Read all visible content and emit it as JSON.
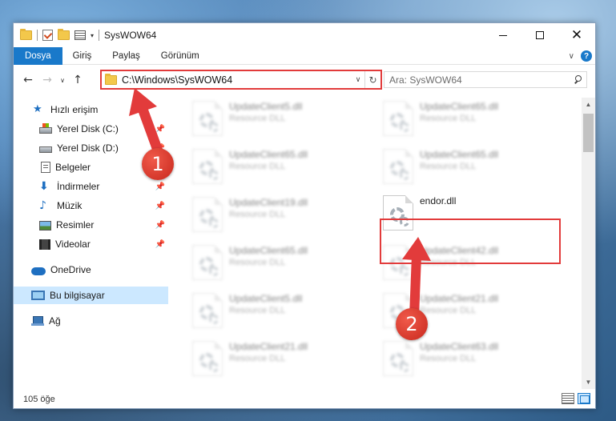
{
  "window": {
    "title": "SysWOW64"
  },
  "ribbon": {
    "tabs": [
      "Dosya",
      "Giriş",
      "Paylaş",
      "Görünüm"
    ]
  },
  "address": {
    "path": "C:\\Windows\\SysWOW64"
  },
  "search": {
    "placeholder": "Ara: SysWOW64"
  },
  "sidebar": {
    "items": [
      {
        "label": "Hızlı erişim",
        "icon": "star-icon",
        "pinned": false
      },
      {
        "label": "Yerel Disk (C:)",
        "icon": "drive-c-icon",
        "pinned": true
      },
      {
        "label": "Yerel Disk (D:)",
        "icon": "drive-icon",
        "pinned": true
      },
      {
        "label": "Belgeler",
        "icon": "documents-icon",
        "pinned": true
      },
      {
        "label": "İndirmeler",
        "icon": "download-icon",
        "pinned": true
      },
      {
        "label": "Müzik",
        "icon": "music-icon",
        "pinned": true
      },
      {
        "label": "Resimler",
        "icon": "pictures-icon",
        "pinned": true
      },
      {
        "label": "Videolar",
        "icon": "videos-icon",
        "pinned": true
      },
      {
        "label": "OneDrive",
        "icon": "onedrive-icon",
        "pinned": false
      },
      {
        "label": "Bu bilgisayar",
        "icon": "this-pc-icon",
        "pinned": false,
        "selected": true
      },
      {
        "label": "Ağ",
        "icon": "network-icon",
        "pinned": false
      }
    ]
  },
  "files": [
    {
      "name": "UpdateClient5.dll",
      "desc": "Resource DLL",
      "blurred": true
    },
    {
      "name": "UpdateClient65.dll",
      "desc": "Resource DLL",
      "blurred": true
    },
    {
      "name": "UpdateClient65.dll",
      "desc": "Resource DLL",
      "blurred": true
    },
    {
      "name": "UpdateClient65.dll",
      "desc": "Resource DLL",
      "blurred": true
    },
    {
      "name": "UpdateClient19.dll",
      "desc": "Resource DLL",
      "blurred": true
    },
    {
      "name": "endor.dll",
      "desc": "",
      "blurred": false,
      "highlighted": true
    },
    {
      "name": "UpdateClient65.dll",
      "desc": "Resource DLL",
      "blurred": true
    },
    {
      "name": "UpdateClient42.dll",
      "desc": "Resource DLL",
      "blurred": true
    },
    {
      "name": "UpdateClient5.dll",
      "desc": "Resource DLL",
      "blurred": true
    },
    {
      "name": "UpdateClient21.dll",
      "desc": "Resource DLL",
      "blurred": true
    },
    {
      "name": "UpdateClient21.dll",
      "desc": "Resource DLL",
      "blurred": true
    },
    {
      "name": "UpdateClient63.dll",
      "desc": "Resource DLL",
      "blurred": true
    }
  ],
  "status": {
    "item_count": "105 öğe"
  },
  "annotations": {
    "step1": "1",
    "step2": "2",
    "color": "#e23b3b"
  }
}
